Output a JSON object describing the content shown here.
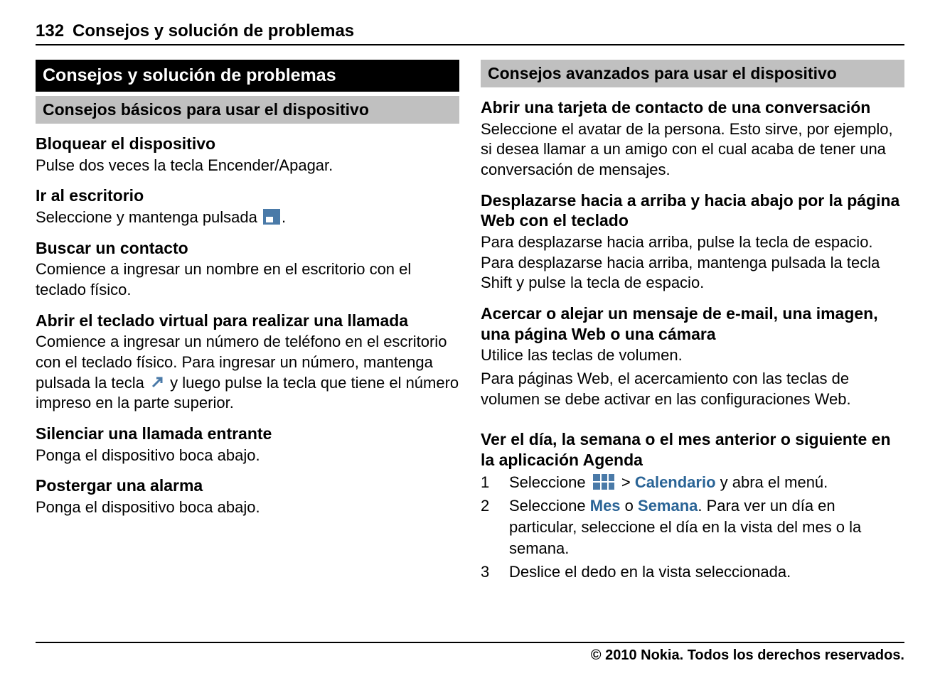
{
  "header": {
    "page_number": "132",
    "title": "Consejos y solución de problemas"
  },
  "left": {
    "chapter": "Consejos y solución de problemas",
    "subsection": "Consejos básicos para usar el dispositivo",
    "s1_h": "Bloquear el dispositivo",
    "s1_p": "Pulse dos veces la tecla Encender/Apagar.",
    "s2_h": "Ir al escritorio",
    "s2_p": "Seleccione y mantenga pulsada ",
    "s2_after": ".",
    "s3_h": "Buscar un contacto",
    "s3_p": "Comience a ingresar un nombre en el escritorio con el teclado físico.",
    "s4_h": "Abrir el teclado virtual para realizar una llamada",
    "s4_p1": "Comience a ingresar un número de teléfono en el escritorio con el teclado físico. Para ingresar un número, mantenga pulsada la tecla ",
    "s4_p2": " y luego pulse la tecla que tiene el número impreso en la parte superior.",
    "s5_h": "Silenciar una llamada entrante",
    "s5_p": "Ponga el dispositivo boca abajo.",
    "s6_h": "Postergar una alarma",
    "s6_p": "Ponga el dispositivo boca abajo."
  },
  "right": {
    "subsection": "Consejos avanzados para usar el dispositivo",
    "s1_h": "Abrir una tarjeta de contacto de una conversación",
    "s1_p": "Seleccione el avatar de la persona. Esto sirve, por ejemplo, si desea llamar a un amigo con el cual acaba de tener una conversación de mensajes.",
    "s2_h": "Desplazarse hacia a arriba y hacia abajo por la página Web con el teclado",
    "s2_p": "Para desplazarse hacia arriba, pulse la tecla de espacio. Para desplazarse hacia arriba, mantenga pulsada la tecla Shift y pulse la tecla de espacio.",
    "s3_h": "Acercar o alejar un mensaje de e-mail, una imagen, una página Web o una cámara",
    "s3_p1": "Utilice las teclas de volumen.",
    "s3_p2": "Para páginas Web, el acercamiento con las teclas de volumen se debe activar en las configuraciones Web.",
    "s4_h": "Ver el día, la semana o el mes anterior o siguiente en la aplicación Agenda",
    "step1_a": "Seleccione ",
    "step1_b": " > ",
    "step1_link": "Calendario",
    "step1_c": " y abra el menú.",
    "step2_a": "Seleccione ",
    "step2_mes": "Mes",
    "step2_o": " o ",
    "step2_semana": "Semana",
    "step2_b": ". Para ver un día en particular, seleccione el día en la vista del mes o la semana.",
    "step3": "Deslice el dedo en la vista seleccionada."
  },
  "footer": "© 2010 Nokia. Todos los derechos reservados."
}
